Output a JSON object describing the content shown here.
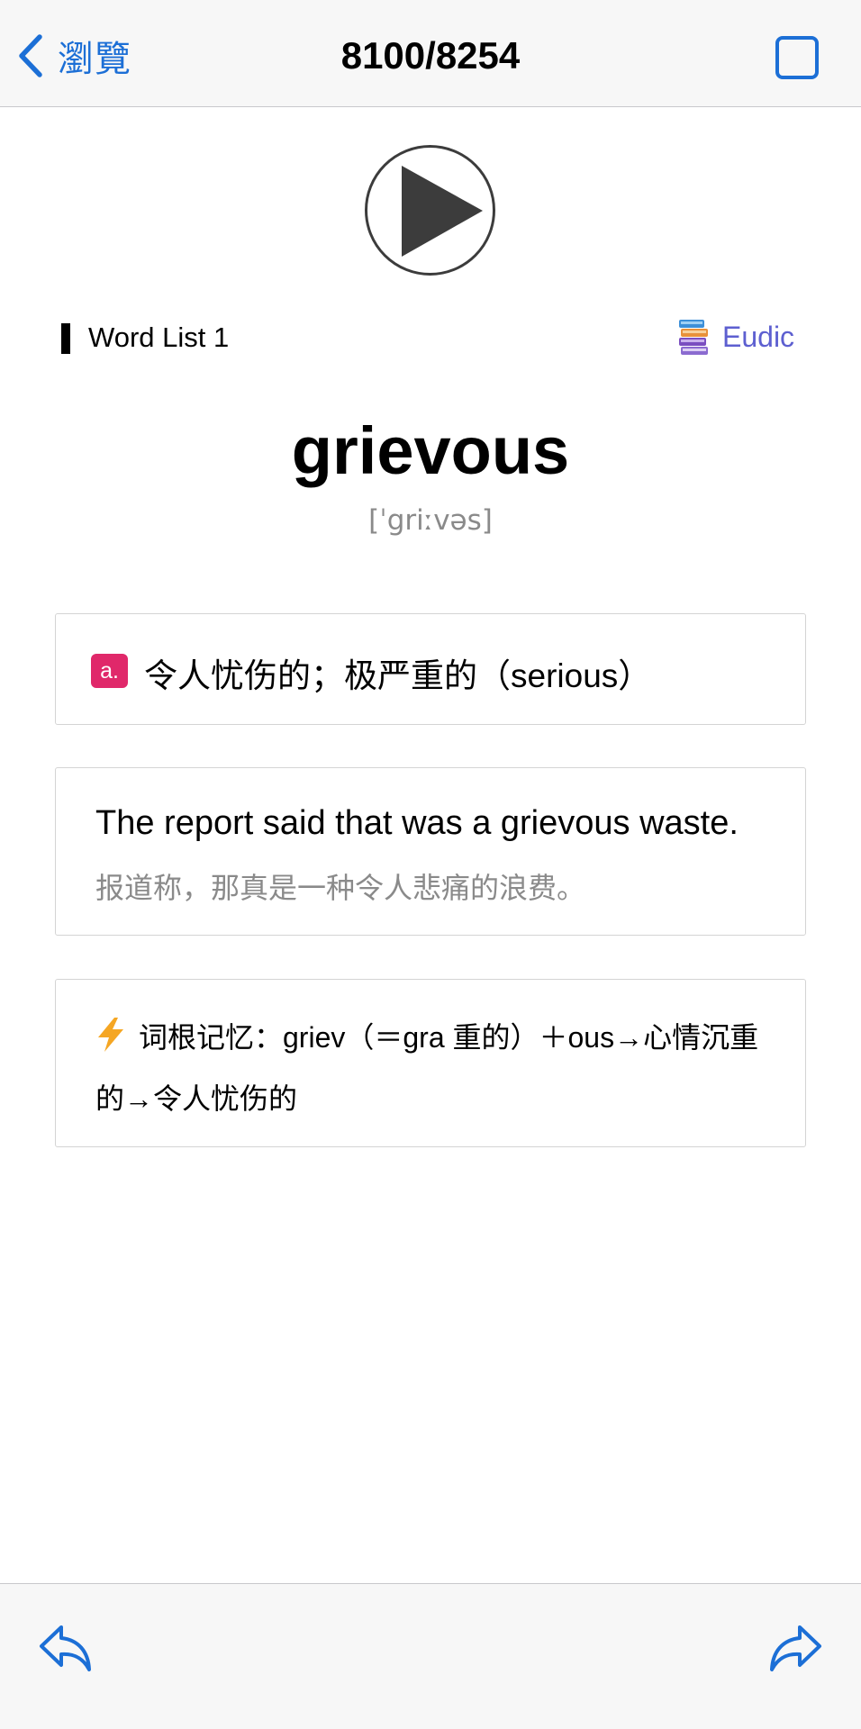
{
  "nav": {
    "back_label": "瀏覽",
    "title": "8100/8254"
  },
  "header": {
    "list_name": "Word List 1",
    "dict_label": "Eudic"
  },
  "word": {
    "headword": "grievous",
    "phonetic": "[ˈgriːvəs]"
  },
  "definition": {
    "pos": "a.",
    "text": "令人忧伤的；极严重的（serious）"
  },
  "example": {
    "en": "The report said that was a grievous waste.",
    "zh": "报道称，那真是一种令人悲痛的浪费。"
  },
  "memory": {
    "text": "词根记忆：griev（＝gra 重的）＋ous→心情沉重的→令人忧伤的"
  },
  "colors": {
    "accent": "#1c6fd6",
    "pos_badge": "#e0286a",
    "eudic": "#5d5fd0"
  }
}
